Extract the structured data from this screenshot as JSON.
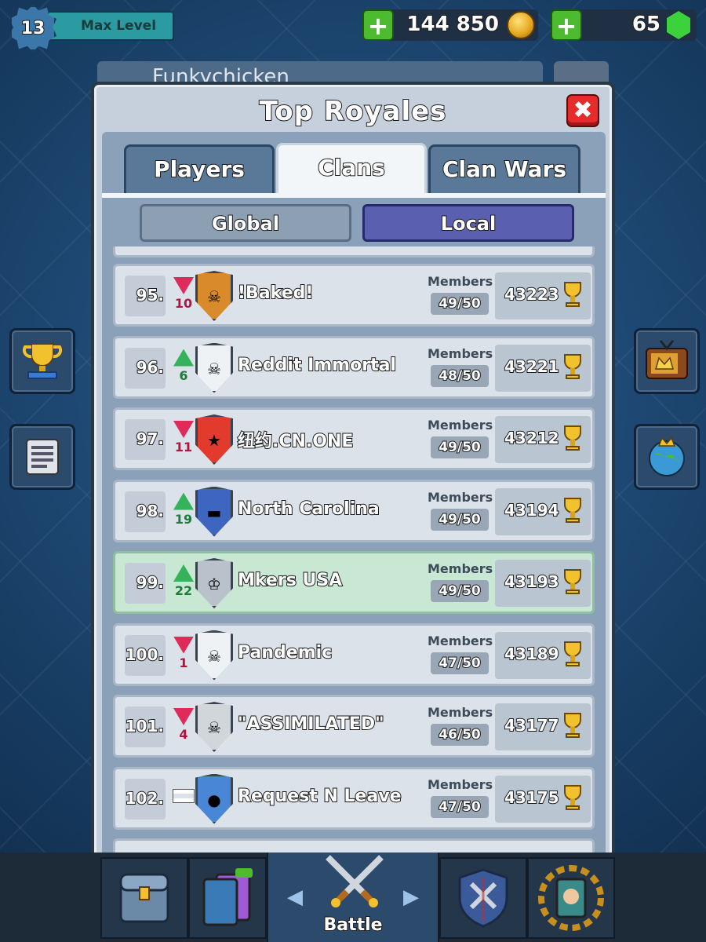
{
  "top_bar": {
    "level": "13",
    "level_label": "Max Level",
    "gold": "144 850",
    "gems": "65"
  },
  "behind": {
    "player_name": "Funkychicken"
  },
  "modal": {
    "title": "Top Royales",
    "close_label": "✖",
    "tabs": [
      {
        "label": "Players",
        "active": false
      },
      {
        "label": "Clans",
        "active": true
      },
      {
        "label": "Clan Wars",
        "active": false
      }
    ],
    "segments": {
      "global": "Global",
      "local": "Local",
      "selected": "Local"
    },
    "members_label": "Members",
    "rows": [
      {
        "rank": "95.",
        "trend": "down",
        "change": "10",
        "name": "!Baked!",
        "members": "49/50",
        "trophies": "43223",
        "badge_color": "#d98a2b"
      },
      {
        "rank": "96.",
        "trend": "up",
        "change": "6",
        "name": "Reddit Immortal",
        "members": "48/50",
        "trophies": "43221",
        "badge_color": "#eef2f5"
      },
      {
        "rank": "97.",
        "trend": "down",
        "change": "11",
        "name": "纽约.CN.ONE",
        "members": "49/50",
        "trophies": "43212",
        "badge_color": "#e23b2e"
      },
      {
        "rank": "98.",
        "trend": "up",
        "change": "19",
        "name": "North Carolina",
        "members": "49/50",
        "trophies": "43194",
        "badge_color": "#3e66c0"
      },
      {
        "rank": "99.",
        "trend": "up",
        "change": "22",
        "name": "Mkers USA",
        "members": "49/50",
        "trophies": "43193",
        "badge_color": "#b9c2cb",
        "highlight": true
      },
      {
        "rank": "100.",
        "trend": "down",
        "change": "1",
        "name": "Pandemic",
        "members": "47/50",
        "trophies": "43189",
        "badge_color": "#eef2f5"
      },
      {
        "rank": "101.",
        "trend": "down",
        "change": "4",
        "name": "\"ASSIMILATED\"",
        "members": "46/50",
        "trophies": "43177",
        "badge_color": "#d1d6db"
      },
      {
        "rank": "102.",
        "trend": "same",
        "change": "",
        "name": "Request N Leave",
        "members": "47/50",
        "trophies": "43175",
        "badge_color": "#4a86d6"
      }
    ]
  },
  "bottom_nav": {
    "battle_label": "Battle"
  },
  "colors": {
    "gold": "#f2c12e",
    "up": "#34b35a",
    "down": "#e02a5a",
    "local_segment": "#5a5fb0"
  }
}
